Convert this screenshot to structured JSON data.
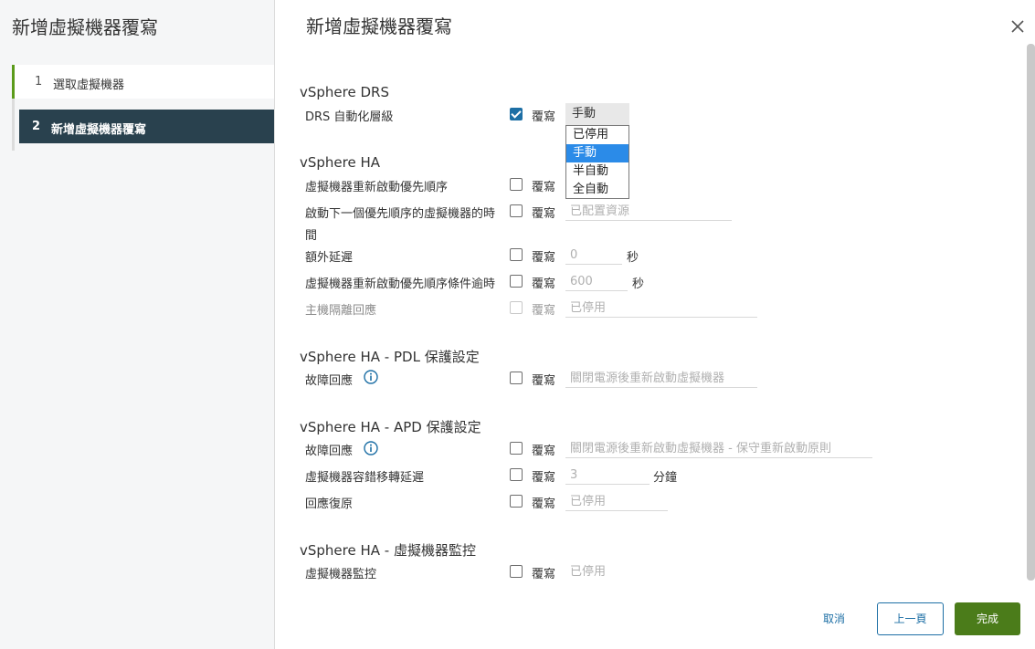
{
  "sidebar": {
    "title": "新增虛擬機器覆寫",
    "steps": [
      {
        "number": "1",
        "label": "選取虛擬機器"
      },
      {
        "number": "2",
        "label": "新增虛擬機器覆寫"
      }
    ]
  },
  "main": {
    "title": "新增虛擬機器覆寫",
    "override_label": "覆寫",
    "sections": {
      "drs": {
        "title": "vSphere DRS",
        "automation_label": "DRS 自動化層級",
        "automation_value": "手動",
        "automation_options": [
          "已停用",
          "手動",
          "半自動",
          "全自動"
        ]
      },
      "ha": {
        "title": "vSphere HA",
        "restart_priority_label": "虛擬機器重新啟動優先順序",
        "next_priority_label_line1": "啟動下一個優先順序的虛擬機器的時",
        "next_priority_label_line2": "間",
        "next_priority_value": "已配置資源",
        "extra_delay_label": "額外延遲",
        "extra_delay_value": "0",
        "extra_delay_unit": "秒",
        "priority_timeout_label": "虛擬機器重新啟動優先順序條件逾時",
        "priority_timeout_value": "600",
        "priority_timeout_unit": "秒",
        "isolation_label": "主機隔離回應",
        "isolation_value": "已停用"
      },
      "pdl": {
        "title": "vSphere HA - PDL 保護設定",
        "failure_label": "故障回應",
        "failure_value": "關閉電源後重新啟動虛擬機器"
      },
      "apd": {
        "title": "vSphere HA - APD 保護設定",
        "failure_label": "故障回應",
        "failure_value": "關閉電源後重新啟動虛擬機器 - 保守重新啟動原則",
        "failover_delay_label": "虛擬機器容錯移轉延遲",
        "failover_delay_value": "3",
        "failover_delay_unit": "分鐘",
        "recovery_label": "回應復原",
        "recovery_value": "已停用"
      },
      "monitoring": {
        "title": "vSphere HA - 虛擬機器監控",
        "vm_monitoring_label": "虛擬機器監控",
        "vm_monitoring_value": "已停用"
      }
    }
  },
  "footer": {
    "cancel": "取消",
    "back": "上一頁",
    "finish": "完成"
  },
  "colors": {
    "accent": "#1d6fa5",
    "finish_button": "#4b7c1a",
    "active_step": "#29414e",
    "step_marker": "#5b9b1a",
    "dropdown_highlight": "#2b8be8"
  }
}
